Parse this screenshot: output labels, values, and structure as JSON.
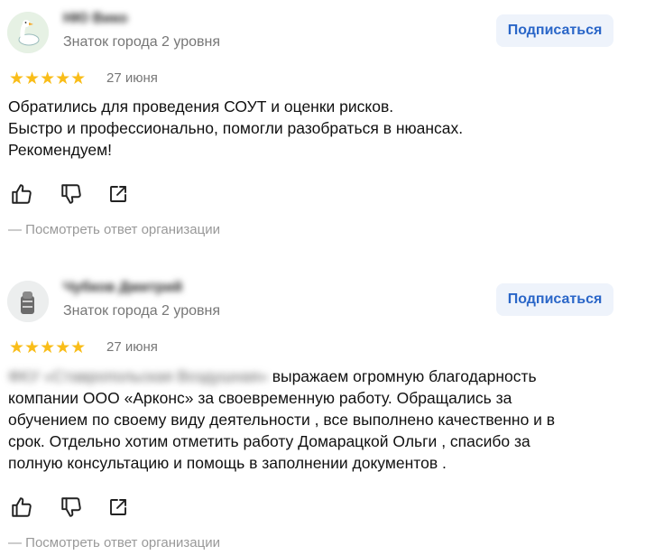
{
  "reviews": [
    {
      "author": "НЮ Вико",
      "level": "Знаток города 2 уровня",
      "subscribe": "Подписаться",
      "stars": "★★★★★",
      "date": "27 июня",
      "lines": [
        "Обратились для проведения СОУТ и оценки рисков.",
        "Быстро и профессионально, помогли разобраться в нюансах.",
        "Рекомендуем!"
      ],
      "response_link": "— Посмотреть ответ организации"
    },
    {
      "author": "Чубков Дмитрий",
      "level": "Знаток города 2 уровня",
      "subscribe": "Подписаться",
      "stars": "★★★★★",
      "date": "27 июня",
      "blurred_prefix": "ФКУ «Ставропольская Воздушная»",
      "text_first": " выражаем огромную благодарность",
      "lines": [
        "компании ООО «Арконс» за своевременную работу. Обращались за",
        "обучением по своему виду деятельности , все выполнено качественно и в",
        "срок. Отдельно хотим отметить работу Домарацкой Ольги , спасибо за",
        "полную консультацию и помощь в заполнении документов ."
      ],
      "response_link": "— Посмотреть ответ организации"
    }
  ],
  "colors": {
    "star": "#f9bd19",
    "subscribe_bg": "#eef3fb",
    "subscribe_text": "#2a66c8",
    "muted": "#777777"
  },
  "icons": [
    "goose-avatar-icon",
    "bag-avatar-icon",
    "thumbs-up-icon",
    "thumbs-down-icon",
    "share-icon"
  ]
}
